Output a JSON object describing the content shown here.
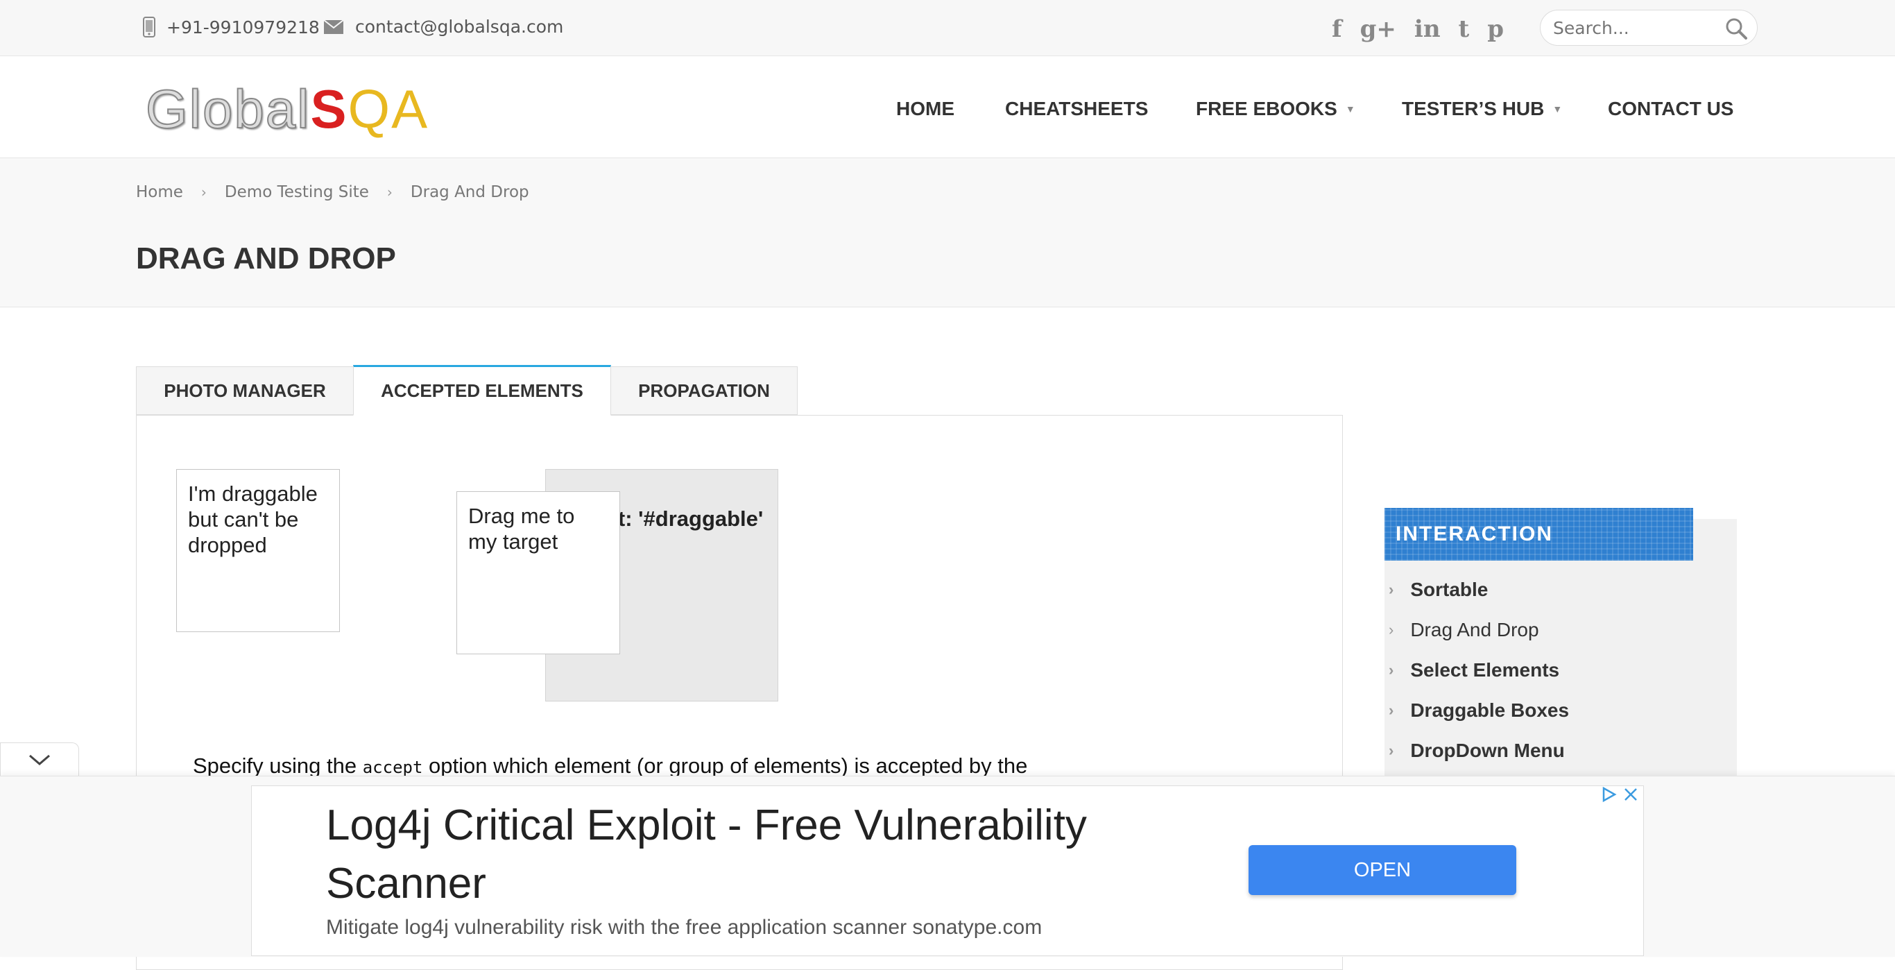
{
  "topbar": {
    "phone": "+91-9910979218",
    "email": "contact@globalsqa.com",
    "social": [
      "f",
      "g+",
      "in",
      "t",
      "p"
    ],
    "search_placeholder": "Search..."
  },
  "logo": {
    "part1": "Global",
    "part2": "S",
    "part3": "QA"
  },
  "nav": {
    "home": "HOME",
    "cheatsheets": "CHEATSHEETS",
    "ebooks": "FREE EBOOKS",
    "hub": "TESTER’S HUB",
    "contact": "CONTACT US"
  },
  "breadcrumb": [
    "Home",
    "Demo Testing Site",
    "Drag And Drop"
  ],
  "page_title": "DRAG AND DROP",
  "tabs": [
    "PHOTO MANAGER",
    "ACCEPTED ELEMENTS",
    "PROPAGATION"
  ],
  "demo": {
    "non_valid": "I'm draggable but can't be dropped",
    "draggable": "Drag me to my target",
    "droppable": "accept: '#draggable'",
    "desc_before": "Specify using the",
    "desc_code": "accept",
    "desc_after": "option which element (or group of elements) is accepted by the"
  },
  "sidebar": {
    "heading": "INTERACTION",
    "items": [
      "Sortable",
      "Drag And Drop",
      "Select Elements",
      "Draggable Boxes",
      "DropDown Menu"
    ]
  },
  "ad": {
    "title": "Log4j Critical Exploit - Free Vulnerability Scanner",
    "subtitle": "Mitigate log4j vulnerability risk with the free application scanner sonatype.com",
    "button": "OPEN"
  },
  "colors": {
    "accent": "#29a8e0",
    "sidebar_head": "#2f80d0",
    "ad_button": "#3b86f0"
  }
}
